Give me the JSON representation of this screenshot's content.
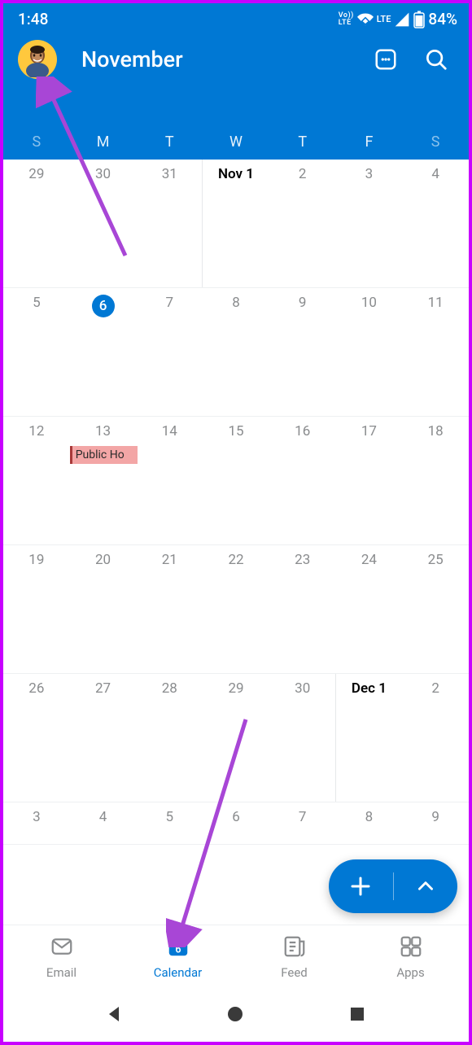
{
  "status": {
    "time": "1:48",
    "volte": "Vo\nLTE",
    "lte": "LTE",
    "battery": "84%"
  },
  "header": {
    "month": "November",
    "weekdays": [
      "S",
      "M",
      "T",
      "W",
      "T",
      "F",
      "S"
    ]
  },
  "calendar": {
    "weeks": [
      {
        "cells": [
          {
            "label": "29",
            "type": "prev"
          },
          {
            "label": "30",
            "type": "prev"
          },
          {
            "label": "31",
            "type": "prev",
            "sepRight": true
          },
          {
            "label": "Nov 1",
            "type": "month-start"
          },
          {
            "label": "2"
          },
          {
            "label": "3"
          },
          {
            "label": "4"
          }
        ]
      },
      {
        "cells": [
          {
            "label": "5"
          },
          {
            "label": "6",
            "type": "today"
          },
          {
            "label": "7"
          },
          {
            "label": "8"
          },
          {
            "label": "9"
          },
          {
            "label": "10"
          },
          {
            "label": "11"
          }
        ]
      },
      {
        "cells": [
          {
            "label": "12"
          },
          {
            "label": "13",
            "event": "Public Ho"
          },
          {
            "label": "14"
          },
          {
            "label": "15"
          },
          {
            "label": "16"
          },
          {
            "label": "17"
          },
          {
            "label": "18"
          }
        ]
      },
      {
        "cells": [
          {
            "label": "19"
          },
          {
            "label": "20"
          },
          {
            "label": "21"
          },
          {
            "label": "22"
          },
          {
            "label": "23"
          },
          {
            "label": "24"
          },
          {
            "label": "25"
          }
        ]
      },
      {
        "cells": [
          {
            "label": "26"
          },
          {
            "label": "27"
          },
          {
            "label": "28"
          },
          {
            "label": "29"
          },
          {
            "label": "30",
            "sepRight": true
          },
          {
            "label": "Dec 1",
            "type": "month-start"
          },
          {
            "label": "2"
          }
        ]
      },
      {
        "short": true,
        "cells": [
          {
            "label": "3"
          },
          {
            "label": "4"
          },
          {
            "label": "5"
          },
          {
            "label": "6"
          },
          {
            "label": "7"
          },
          {
            "label": "8"
          },
          {
            "label": "9"
          }
        ]
      }
    ]
  },
  "nav": {
    "email": "Email",
    "calendar": "Calendar",
    "calendar_day": "6",
    "feed": "Feed",
    "apps": "Apps"
  }
}
